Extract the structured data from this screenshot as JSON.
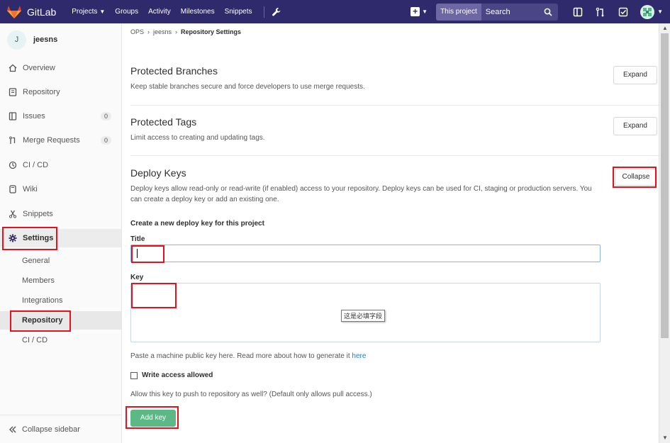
{
  "navbar": {
    "brand": "GitLab",
    "links": [
      "Projects",
      "Groups",
      "Activity",
      "Milestones",
      "Snippets"
    ],
    "scope": "This project",
    "search_placeholder": "Search",
    "bg_color": "#2f2a6b"
  },
  "sidebar": {
    "project_initial": "J",
    "project_name": "jeesns",
    "items": [
      {
        "label": "Overview",
        "icon": "home-icon"
      },
      {
        "label": "Repository",
        "icon": "book-icon"
      },
      {
        "label": "Issues",
        "icon": "issues-icon",
        "count": "0"
      },
      {
        "label": "Merge Requests",
        "icon": "merge-request-icon",
        "count": "0"
      },
      {
        "label": "CI / CD",
        "icon": "rocket-icon"
      },
      {
        "label": "Wiki",
        "icon": "book-open-icon"
      },
      {
        "label": "Snippets",
        "icon": "scissors-icon"
      },
      {
        "label": "Settings",
        "icon": "gear-icon"
      }
    ],
    "sub_items": [
      "General",
      "Members",
      "Integrations",
      "Repository",
      "CI / CD"
    ],
    "collapse_label": "Collapse sidebar"
  },
  "breadcrumb": {
    "items": [
      "OPS",
      "jeesns"
    ],
    "current": "Repository Settings"
  },
  "protected_branches": {
    "title": "Protected Branches",
    "desc": "Keep stable branches secure and force developers to use merge requests.",
    "button": "Expand"
  },
  "protected_tags": {
    "title": "Protected Tags",
    "desc": "Limit access to creating and updating tags.",
    "button": "Expand"
  },
  "deploy_keys": {
    "title": "Deploy Keys",
    "desc": "Deploy keys allow read-only or read-write (if enabled) access to your repository. Deploy keys can be used for CI, staging or production servers. You can create a deploy key or add an existing one.",
    "button": "Collapse",
    "form_heading": "Create a new deploy key for this project",
    "title_label": "Title",
    "title_value": "",
    "key_label": "Key",
    "key_value": "",
    "tooltip": "这是必填字段",
    "help_text": "Paste a machine public key here. Read more about how to generate it",
    "help_link": "here",
    "write_access_label": "Write access allowed",
    "write_access_checked": false,
    "allow_push_text": "Allow this key to push to repository as well? (Default only allows pull access.)",
    "add_button": "Add key",
    "add_button_color": "#5cb885"
  },
  "annotation_color": "#e8101a"
}
